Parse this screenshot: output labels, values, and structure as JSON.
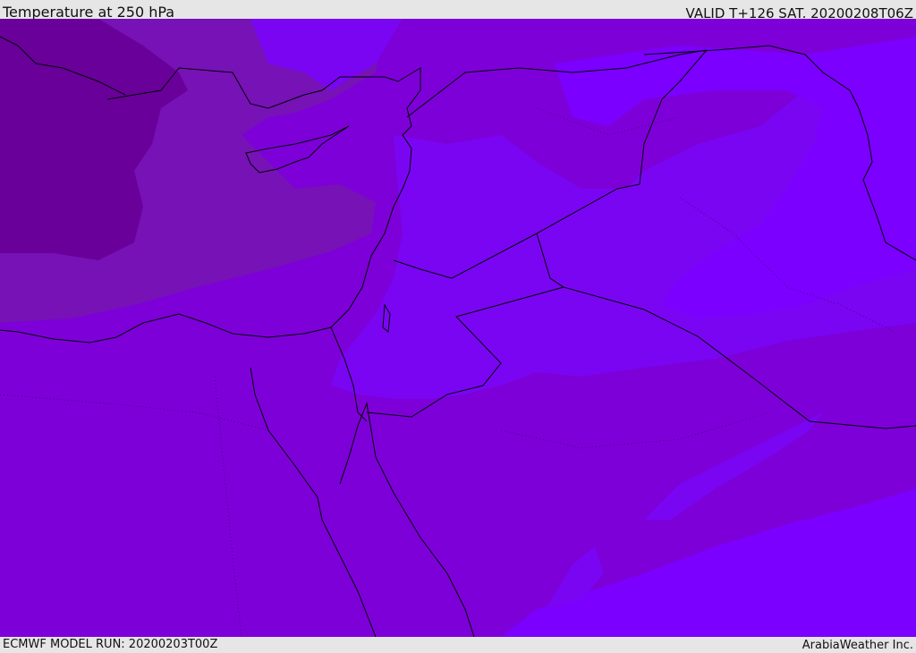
{
  "header": {
    "title": "Temperature at 250 hPa",
    "valid": "VALID T+126 SAT. 20200208T06Z"
  },
  "footer": {
    "model_run": "ECMWF MODEL RUN: 20200203T00Z",
    "credit": "ArabiaWeather Inc."
  },
  "map": {
    "colors": {
      "coldest": "#69009a",
      "colder": "#7612b6",
      "base": "#7d00d9",
      "warm": "#7a05f2",
      "warmest": "#7b00ff",
      "coastline": "#000000"
    }
  }
}
